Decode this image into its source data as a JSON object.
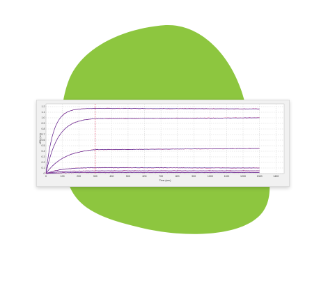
{
  "colors": {
    "background": "#ffffff",
    "blob": "#8dc63f",
    "card": "#f1f1f1",
    "plot_bg": "#ffffff",
    "grid": "#c8c8c8",
    "marker_line": "#e0365a",
    "raw_data": "#d8508c",
    "fit": "#4b2b9a"
  },
  "chart_data": {
    "type": "line",
    "title": "",
    "xlabel": "Time (sec)",
    "ylabel": "nRU (nm)",
    "xlim": [
      0,
      1450
    ],
    "ylim": [
      0,
      1.25
    ],
    "xticks": [
      "0",
      "100",
      "200",
      "300",
      "400",
      "500",
      "600",
      "700",
      "800",
      "900",
      "1000",
      "1100",
      "1200",
      "1300",
      "1400"
    ],
    "yticks": [
      "0",
      "0.1",
      "0.2",
      "0.3",
      "0.4",
      "0.5",
      "0.6",
      "0.7",
      "0.8",
      "0.9",
      "1.0",
      "1.1",
      "1.2"
    ],
    "grid": true,
    "association_end_x": 300,
    "series": [
      {
        "plateau": 1.17,
        "k_on": 0.022,
        "end_value": 1.16
      },
      {
        "plateau": 1.0,
        "k_on": 0.014,
        "end_value": 1.0
      },
      {
        "plateau": 0.46,
        "k_on": 0.009,
        "end_value": 0.45
      },
      {
        "plateau": 0.11,
        "k_on": 0.011,
        "end_value": 0.1
      },
      {
        "plateau": 0.05,
        "k_on": 0.012,
        "end_value": 0.05
      },
      {
        "plateau": 0.02,
        "k_on": 0.012,
        "end_value": 0.02
      }
    ]
  }
}
